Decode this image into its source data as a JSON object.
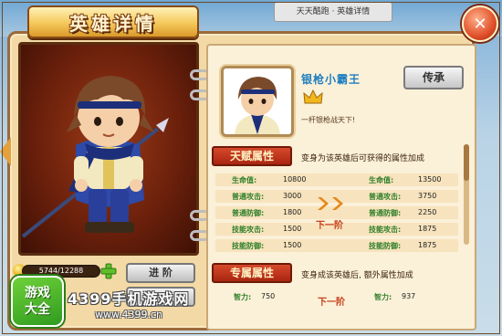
{
  "header": {
    "title": "英雄详情",
    "top_banner": "天天酷跑 · 英雄详情"
  },
  "hero": {
    "name": "银枪小霸王",
    "motto": "一杆银枪战天下!",
    "inherit_label": "传承"
  },
  "talent": {
    "title": "天赋属性",
    "desc": "变身为该英雄后可获得的属性加成",
    "next_label": "下一阶",
    "rows": [
      {
        "label": "生命值:",
        "current": "10800",
        "next": "13500"
      },
      {
        "label": "普通攻击:",
        "current": "3000",
        "next": "3750"
      },
      {
        "label": "普通防御:",
        "current": "1800",
        "next": "2250"
      },
      {
        "label": "技能攻击:",
        "current": "1500",
        "next": "1875"
      },
      {
        "label": "技能防御:",
        "current": "1500",
        "next": "1875"
      }
    ]
  },
  "exclusive": {
    "title": "专属属性",
    "desc": "变身成该英雄后, 额外属性加成",
    "next_label": "下一阶",
    "current_label": "智力:",
    "current_value": "750",
    "next_value": "937"
  },
  "bottom": {
    "exp": "5744/12288",
    "advance_label": "进 阶"
  },
  "watermark": {
    "logo_line1": "游戏",
    "logo_line2": "大全",
    "site_name": "4399手机游戏网",
    "site_url": "www.4399.cn"
  },
  "colors": {
    "accent_red": "#a92510",
    "name_blue": "#1e7fc0",
    "stat_green": "#2f7f2a",
    "panel_bg": "#f3d9a6"
  }
}
